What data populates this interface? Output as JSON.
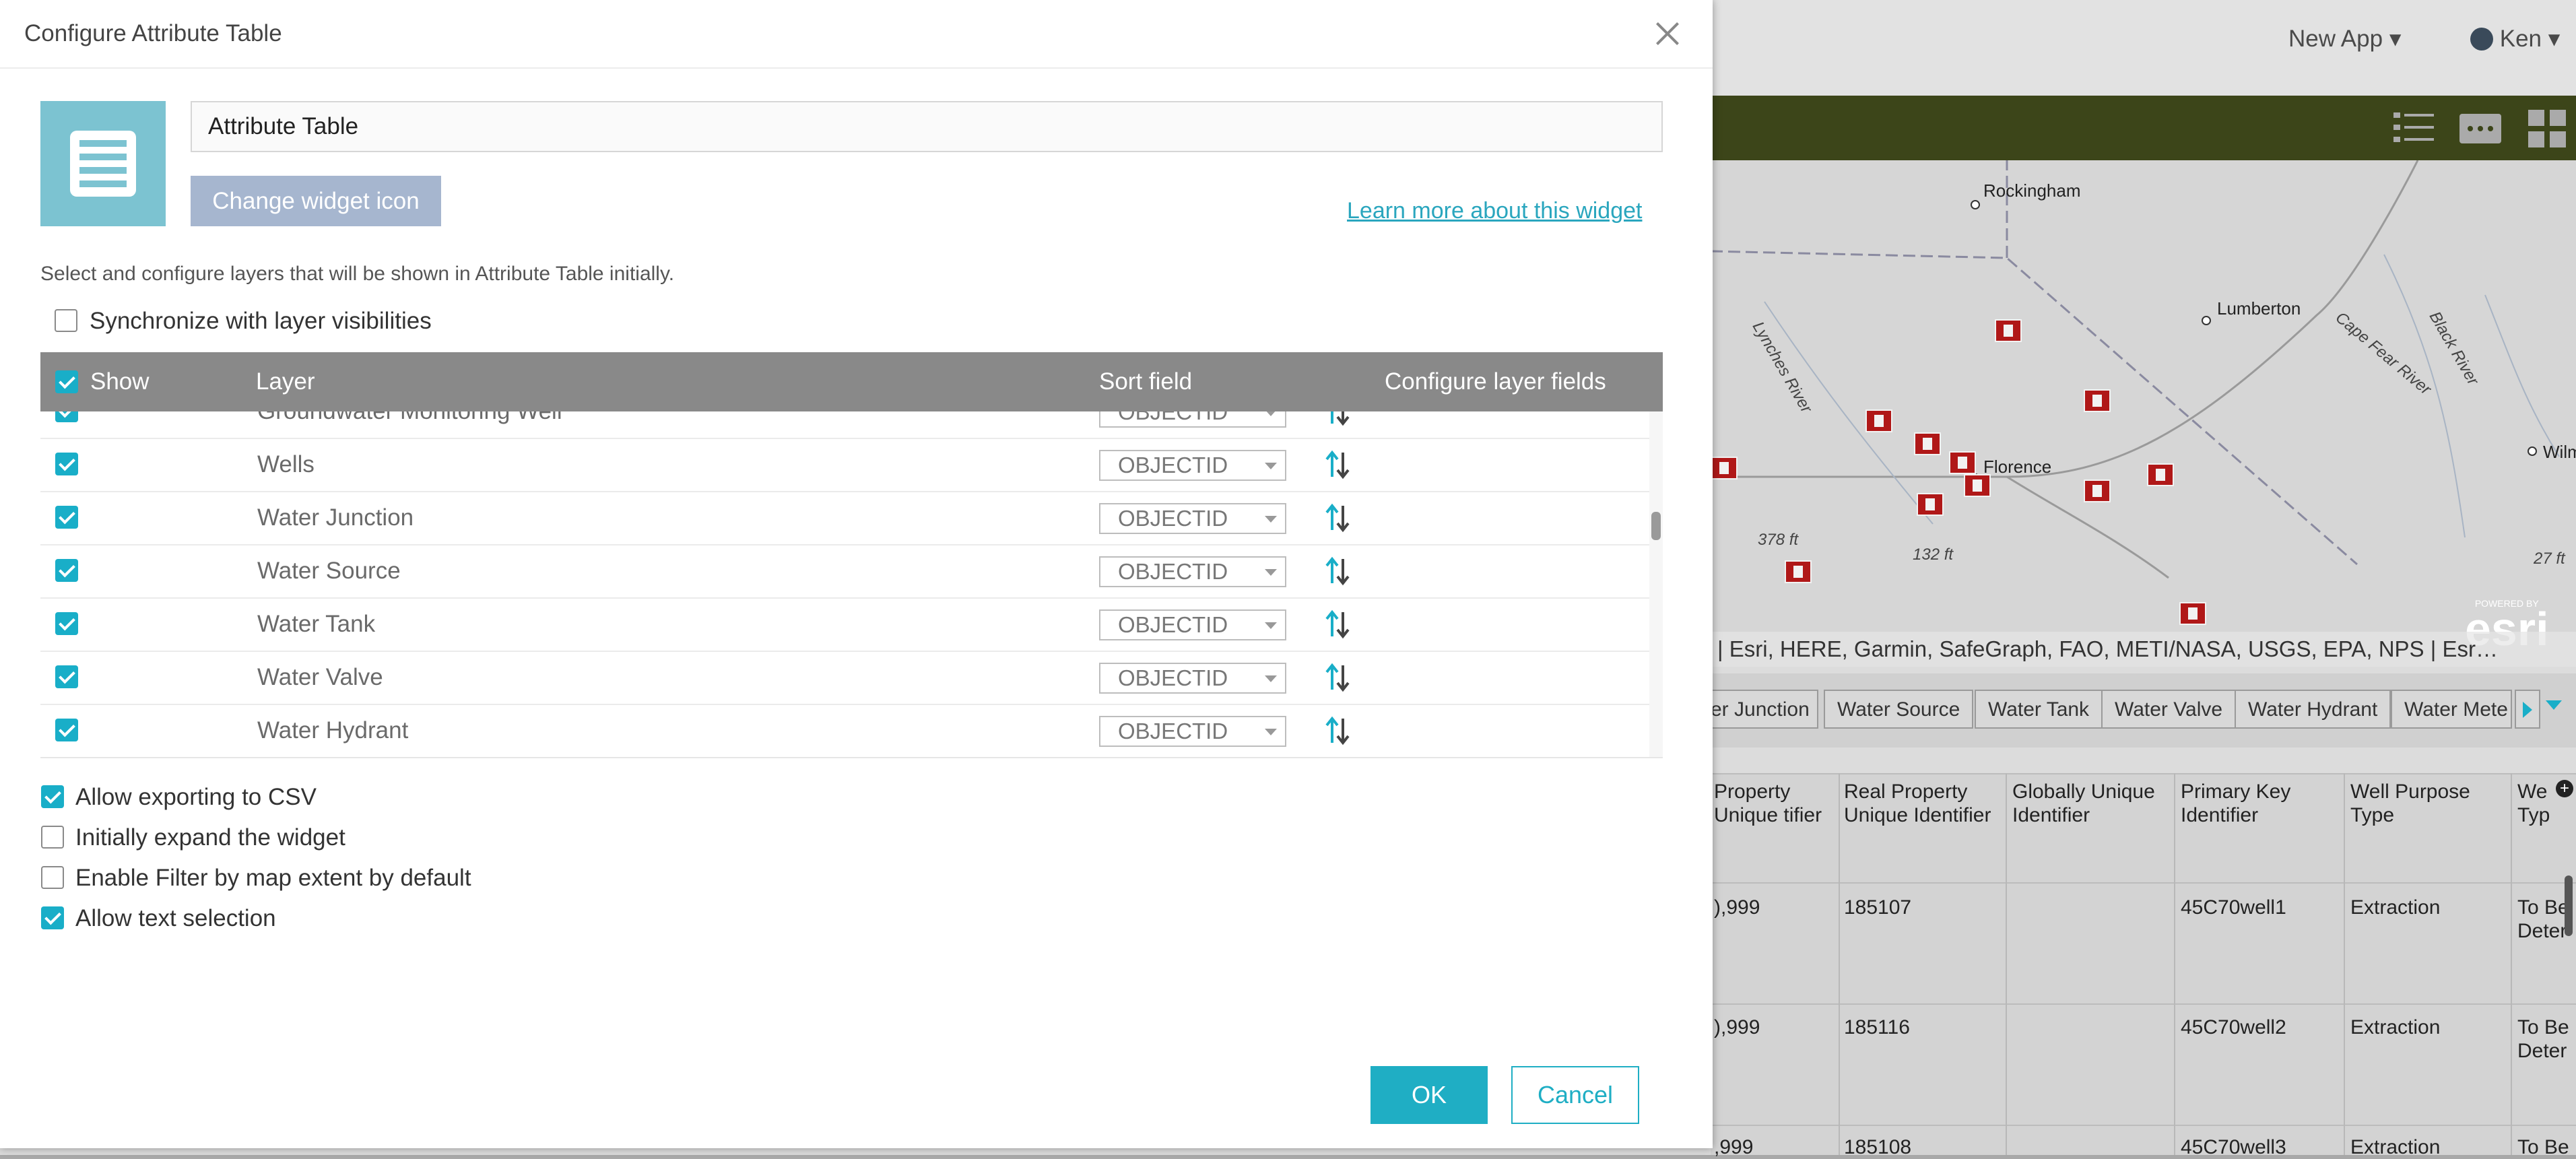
{
  "background_app": {
    "menu": [
      {
        "label": "New App"
      },
      {
        "label": "Ken"
      }
    ],
    "map": {
      "places": [
        "Rockingham",
        "Lumberton",
        "Florence",
        "Wilm"
      ],
      "rivers": [
        "Lynches River",
        "Cape Fear River",
        "Black River"
      ],
      "elevations": [
        "378 ft",
        "132 ft",
        "27 ft"
      ],
      "attribution": "| Esri, HERE, Garmin, SafeGraph, FAO, METI/NASA, USGS, EPA, NPS | Esr…",
      "logo_text": "esri",
      "logo_caption": "POWERED BY"
    },
    "layer_tabs": [
      "er Junction",
      "Water Source",
      "Water Tank",
      "Water Valve",
      "Water Hydrant",
      "Water Mete"
    ],
    "grid": {
      "columns": [
        "Property Unique tifier",
        "Real Property Unique Identifier",
        "Globally Unique Identifier",
        "Primary Key Identifier",
        "Well Purpose Type",
        "We Typ"
      ],
      "rows": [
        [
          "),999",
          "185107",
          "",
          "45C70well1",
          "Extraction",
          "To Be Deter"
        ],
        [
          "),999",
          "185116",
          "",
          "45C70well2",
          "Extraction",
          "To Be Deter"
        ],
        [
          ",999",
          "185108",
          "",
          "45C70well3",
          "Extraction",
          "To Be"
        ]
      ]
    }
  },
  "dialog": {
    "title": "Configure Attribute Table",
    "widget_name": "Attribute Table",
    "change_icon_label": "Change widget icon",
    "learn_more_label": "Learn more about this widget",
    "description": "Select and configure layers that will be shown in Attribute Table initially.",
    "sync_label": "Synchronize with layer visibilities",
    "sync_checked": false,
    "table": {
      "headers": {
        "show": "Show",
        "layer": "Layer",
        "sort": "Sort field",
        "configure": "Configure layer fields"
      },
      "rows": [
        {
          "layer": "Groundwater Monitoring Well",
          "sort": "OBJECTID",
          "checked": true
        },
        {
          "layer": "Wells",
          "sort": "OBJECTID",
          "checked": true
        },
        {
          "layer": "Water Junction",
          "sort": "OBJECTID",
          "checked": true
        },
        {
          "layer": "Water Source",
          "sort": "OBJECTID",
          "checked": true
        },
        {
          "layer": "Water Tank",
          "sort": "OBJECTID",
          "checked": true
        },
        {
          "layer": "Water Valve",
          "sort": "OBJECTID",
          "checked": true
        },
        {
          "layer": "Water Hydrant",
          "sort": "OBJECTID",
          "checked": true
        }
      ]
    },
    "options": [
      {
        "label": "Allow exporting to CSV",
        "checked": true
      },
      {
        "label": "Initially expand the widget",
        "checked": false
      },
      {
        "label": "Enable Filter by map extent by default",
        "checked": false
      },
      {
        "label": "Allow text selection",
        "checked": true
      }
    ],
    "ok_label": "OK",
    "cancel_label": "Cancel"
  },
  "colors": {
    "accent": "#1faec4",
    "header_gray": "#898989",
    "widget_icon_bg": "#7cc3d1",
    "map_header_green": "#3c4519",
    "marker_red": "#b01818"
  }
}
